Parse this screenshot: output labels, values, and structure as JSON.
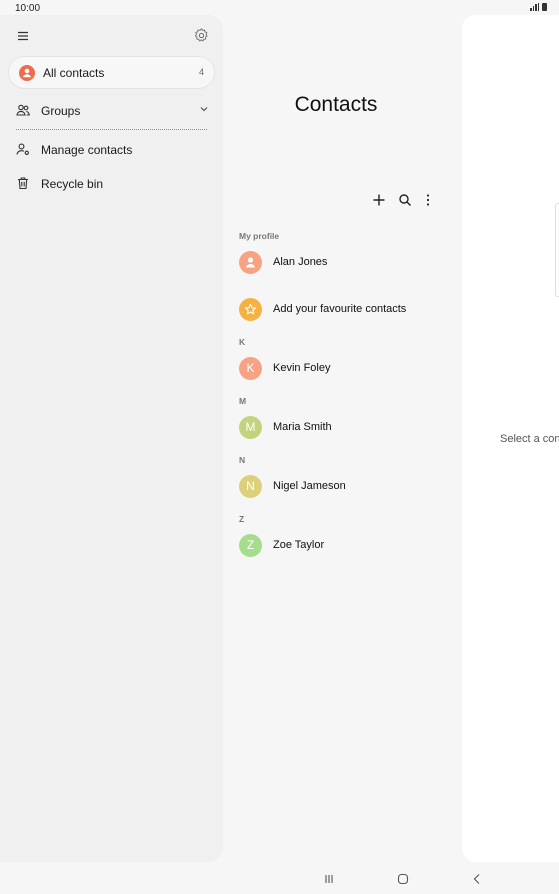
{
  "status_bar": {
    "time": "10:00"
  },
  "drawer": {
    "all_contacts": {
      "label": "All contacts",
      "count": "4"
    },
    "groups": {
      "label": "Groups"
    },
    "manage": {
      "label": "Manage contacts"
    },
    "recycle": {
      "label": "Recycle bin"
    }
  },
  "main": {
    "title": "Contacts",
    "my_profile_label": "My profile",
    "profile": {
      "name": "Alan Jones"
    },
    "favourites": {
      "label": "Add your favourite contacts"
    },
    "sections": [
      {
        "letter": "K",
        "name": "Kevin Foley",
        "initial": "K",
        "color": "#f7a283"
      },
      {
        "letter": "M",
        "name": "Maria Smith",
        "initial": "M",
        "color": "#c1d47c"
      },
      {
        "letter": "N",
        "name": "Nigel Jameson",
        "initial": "N",
        "color": "#ddd07a"
      },
      {
        "letter": "Z",
        "name": "Zoe Taylor",
        "initial": "Z",
        "color": "#a6dc8e"
      }
    ]
  },
  "detail": {
    "hint": "Select a con"
  },
  "colors": {
    "accent": "#ef6b4f",
    "favourite": "#f5b244",
    "profile_avatar": "#f7a283"
  }
}
